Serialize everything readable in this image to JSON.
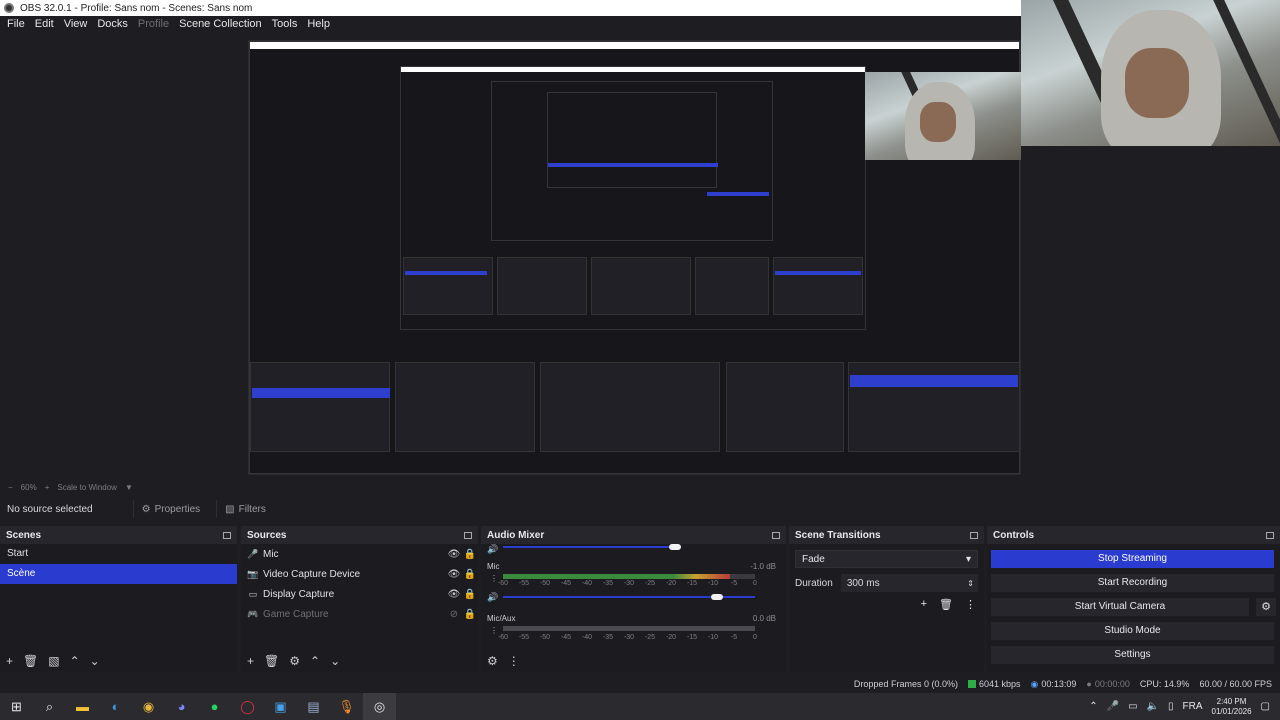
{
  "window": {
    "title": "OBS 32.0.1 - Profile: Sans nom - Scenes: Sans nom"
  },
  "menu": {
    "items": [
      "File",
      "Edit",
      "View",
      "Docks",
      "Profile",
      "Scene Collection",
      "Tools",
      "Help"
    ],
    "disabled": [
      "Profile"
    ]
  },
  "preview_toolbar": {
    "zoom": "60%",
    "scale_mode": "Scale to Window"
  },
  "source_toolbar": {
    "selection_status": "No source selected",
    "properties_label": "Properties",
    "filters_label": "Filters"
  },
  "scenes": {
    "title": "Scenes",
    "items": [
      {
        "label": "Start",
        "selected": false
      },
      {
        "label": "Scène",
        "selected": true
      }
    ]
  },
  "sources": {
    "title": "Sources",
    "items": [
      {
        "label": "Mic",
        "icon": "mic-icon",
        "visible": true
      },
      {
        "label": "Video Capture Device",
        "icon": "camera-icon",
        "visible": true
      },
      {
        "label": "Display Capture",
        "icon": "monitor-icon",
        "visible": true
      },
      {
        "label": "Game Capture",
        "icon": "gamepad-icon",
        "visible": false
      }
    ]
  },
  "audio_mixer": {
    "title": "Audio Mixer",
    "channels": [
      {
        "name": "Mic",
        "db": "-1.0 dB",
        "volume": 0.85,
        "level": 0.9
      },
      {
        "name": "Mic/Aux",
        "db": "0.0 dB",
        "volume": 1.0,
        "level": 0.0
      }
    ],
    "ticks": [
      "-60",
      "-55",
      "-50",
      "-45",
      "-40",
      "-35",
      "-30",
      "-25",
      "-20",
      "-15",
      "-10",
      "-5",
      "0"
    ]
  },
  "scene_transitions": {
    "title": "Scene Transitions",
    "selected": "Fade",
    "duration_label": "Duration",
    "duration_value": "300 ms"
  },
  "controls": {
    "title": "Controls",
    "buttons": [
      {
        "label": "Stop Streaming",
        "active": true
      },
      {
        "label": "Start Recording",
        "active": false
      },
      {
        "label": "Start Virtual Camera",
        "active": false
      },
      {
        "label": "Studio Mode",
        "active": false
      },
      {
        "label": "Settings",
        "active": false
      }
    ]
  },
  "status": {
    "dropped_frames": "Dropped Frames 0 (0.0%)",
    "bitrate": "6041 kbps",
    "stream_time": "00:13:09",
    "record_time": "00:00:00",
    "cpu": "CPU: 14.9%",
    "fps": "60.00 / 60.00 FPS"
  },
  "taskbar": {
    "apps": [
      "windows-start-icon",
      "search-icon",
      "file-explorer-icon",
      "edge-icon",
      "chrome-icon",
      "discord-icon",
      "spotify-icon",
      "opera-icon",
      "app-icon",
      "app-icon",
      "mic-app-icon",
      "obs-icon"
    ],
    "language": "FRA",
    "time": "2:40 PM",
    "date": "01/01/2026"
  },
  "colors": {
    "accent": "#2a3bcf",
    "background": "#1e1e22",
    "panel": "#1c1c20"
  }
}
